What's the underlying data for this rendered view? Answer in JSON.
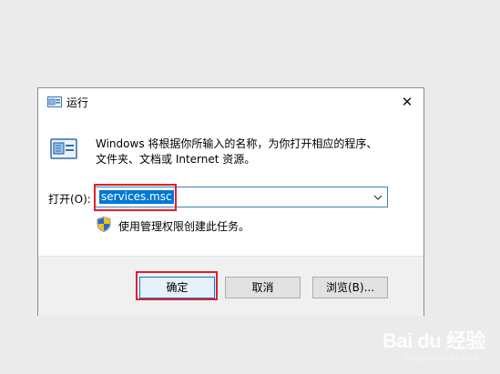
{
  "window": {
    "title": "运行",
    "close_glyph": "✕"
  },
  "description": {
    "line1": "Windows 将根据你所输入的名称，为你打开相应的程序、",
    "line2": "文件夹、文档或 Internet 资源。"
  },
  "open_field": {
    "label": "打开(O):",
    "value": "services.msc"
  },
  "admin_note": "使用管理权限创建此任务。",
  "buttons": {
    "ok": "确定",
    "cancel": "取消",
    "browse": "浏览(B)..."
  },
  "watermark": {
    "brand": "Bai du 经验",
    "url": "jingyan.baidu.com"
  },
  "colors": {
    "highlight": "#e0202a",
    "selection": "#0078d7"
  }
}
